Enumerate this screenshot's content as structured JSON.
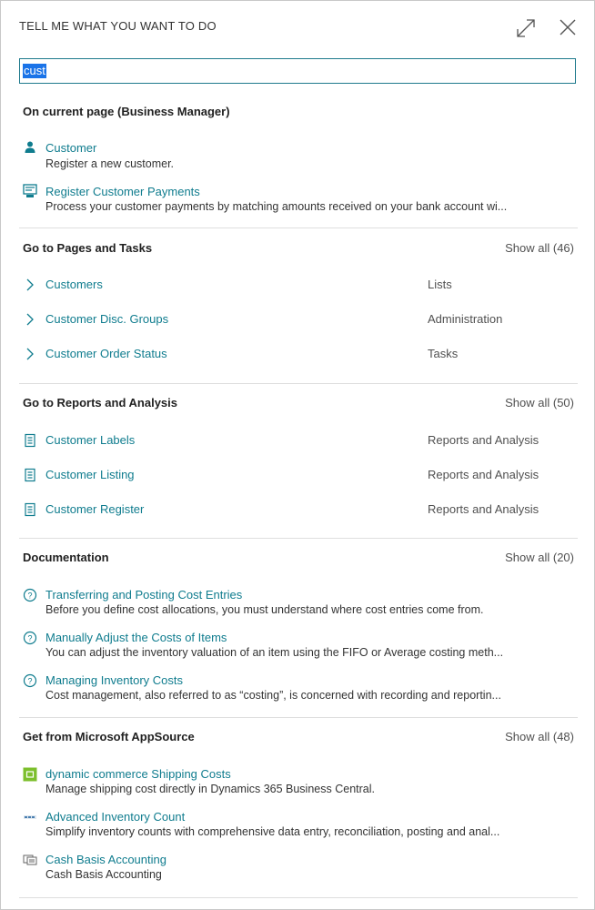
{
  "header": {
    "title": "TELL ME WHAT YOU WANT TO DO"
  },
  "search": {
    "value": "cust"
  },
  "current_page": {
    "title": "On current page (Business Manager)",
    "items": [
      {
        "label": "Customer",
        "description": "Register a new customer.",
        "icon": "person-icon"
      },
      {
        "label": "Register Customer Payments",
        "description": "Process your customer payments by matching amounts received on your bank account wi...",
        "icon": "payment-register-icon"
      }
    ]
  },
  "pages_tasks": {
    "title": "Go to Pages and Tasks",
    "show_all": "Show all (46)",
    "items": [
      {
        "label": "Customers",
        "category": "Lists"
      },
      {
        "label": "Customer Disc. Groups",
        "category": "Administration"
      },
      {
        "label": "Customer Order Status",
        "category": "Tasks"
      }
    ]
  },
  "reports": {
    "title": "Go to Reports and Analysis",
    "show_all": "Show all (50)",
    "items": [
      {
        "label": "Customer Labels",
        "category": "Reports and Analysis"
      },
      {
        "label": "Customer Listing",
        "category": "Reports and Analysis"
      },
      {
        "label": "Customer Register",
        "category": "Reports and Analysis"
      }
    ]
  },
  "documentation": {
    "title": "Documentation",
    "show_all": "Show all (20)",
    "items": [
      {
        "label": "Transferring and Posting Cost Entries",
        "description": "Before you define cost allocations, you must understand where cost entries come from."
      },
      {
        "label": "Manually Adjust the Costs of Items",
        "description": "You can adjust the inventory valuation of an item using the FIFO or Average costing meth..."
      },
      {
        "label": "Managing Inventory Costs",
        "description": "Cost management, also referred to as “costing”, is concerned with recording and reportin..."
      }
    ]
  },
  "appsource": {
    "title": "Get from Microsoft AppSource",
    "show_all": "Show all (48)",
    "items": [
      {
        "label": "dynamic commerce Shipping Costs",
        "description": "Manage shipping cost directly in Dynamics 365 Business Central.",
        "icon": "app-logo-green-icon"
      },
      {
        "label": "Advanced Inventory Count",
        "description": "Simplify inventory counts with comprehensive data entry, reconciliation, posting and anal...",
        "icon": "app-logo-inventory-icon"
      },
      {
        "label": "Cash Basis Accounting",
        "description": "Cash Basis Accounting",
        "icon": "app-logo-cash-icon"
      }
    ]
  },
  "colors": {
    "link": "#0f7c8e",
    "accent": "#1a73e8",
    "divider": "#dedede"
  }
}
